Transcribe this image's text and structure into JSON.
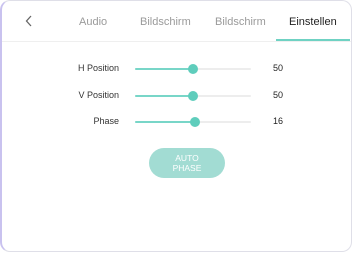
{
  "tabs": [
    {
      "label": "Audio",
      "active": false
    },
    {
      "label": "Bildschirm",
      "active": false
    },
    {
      "label": "Bildschirm",
      "active": false
    },
    {
      "label": "Einstellen",
      "active": true
    }
  ],
  "back_icon": "chevron-left-icon",
  "settings": [
    {
      "label": "H Position",
      "value": "50",
      "fraction": 0.5
    },
    {
      "label": "V Position",
      "value": "50",
      "fraction": 0.5
    },
    {
      "label": "Phase",
      "value": "16",
      "fraction": 0.52
    }
  ],
  "auto_phase": {
    "line1": "AUTO",
    "line2": "PHASE"
  },
  "colors": {
    "accent": "#5fcdbc",
    "accent_light": "#a2dcd3",
    "track": "#ededed"
  }
}
